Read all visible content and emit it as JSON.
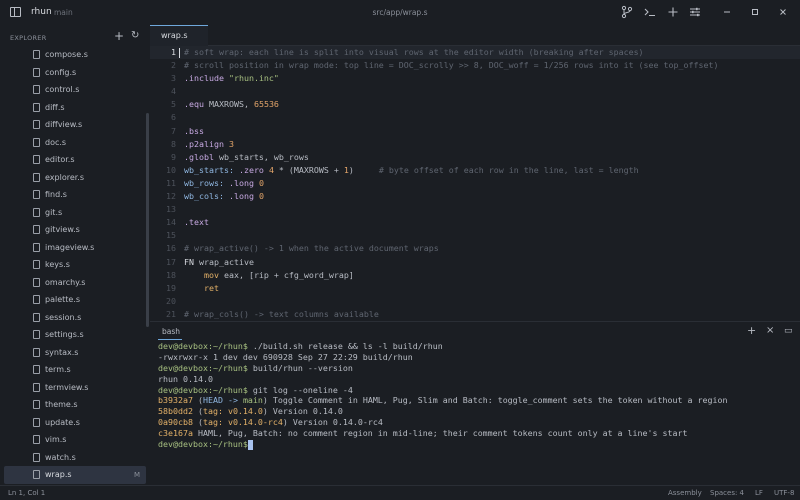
{
  "titlebar": {
    "app_name": "rhun",
    "branch": "main",
    "file_path": "src/app/wrap.s",
    "buttons": [
      "git-icon",
      "terminal-icon",
      "plus-icon",
      "sliders-icon"
    ],
    "window_controls": [
      "minimize",
      "maximize",
      "close"
    ]
  },
  "sidebar": {
    "header": "EXPLORER",
    "items": [
      {
        "label": "compose.s"
      },
      {
        "label": "config.s"
      },
      {
        "label": "control.s"
      },
      {
        "label": "diff.s"
      },
      {
        "label": "diffview.s"
      },
      {
        "label": "doc.s"
      },
      {
        "label": "editor.s"
      },
      {
        "label": "explorer.s"
      },
      {
        "label": "find.s"
      },
      {
        "label": "git.s"
      },
      {
        "label": "gitview.s"
      },
      {
        "label": "imageview.s"
      },
      {
        "label": "keys.s"
      },
      {
        "label": "omarchy.s"
      },
      {
        "label": "palette.s"
      },
      {
        "label": "session.s"
      },
      {
        "label": "settings.s"
      },
      {
        "label": "syntax.s"
      },
      {
        "label": "term.s"
      },
      {
        "label": "termview.s"
      },
      {
        "label": "theme.s"
      },
      {
        "label": "update.s"
      },
      {
        "label": "vim.s"
      },
      {
        "label": "watch.s"
      },
      {
        "label": "wrap.s",
        "badge": "M",
        "active": true
      }
    ]
  },
  "editor": {
    "tab_label": "wrap.s",
    "lines": [
      {
        "n": "1",
        "segs": [
          [
            "t-comment",
            "# soft wrap: each line is split into visual rows at the editor width (breaking after spaces)"
          ]
        ]
      },
      {
        "n": "2",
        "segs": [
          [
            "t-comment",
            "# scroll position in wrap mode: top line = DOC_scrolly >> 8, DOC_woff = 1/256 rows into it (see top_offset)"
          ]
        ]
      },
      {
        "n": "3",
        "segs": [
          [
            "t-dir",
            ".include "
          ],
          [
            "t-str",
            "\"rhun.inc\""
          ]
        ]
      },
      {
        "n": "4",
        "segs": []
      },
      {
        "n": "5",
        "segs": [
          [
            "t-dir",
            ".equ "
          ],
          [
            "t-plain",
            "MAXROWS, "
          ],
          [
            "t-num",
            "65536"
          ]
        ]
      },
      {
        "n": "6",
        "segs": []
      },
      {
        "n": "7",
        "segs": [
          [
            "t-dir",
            ".bss"
          ]
        ]
      },
      {
        "n": "8",
        "segs": [
          [
            "t-dir",
            ".p2align "
          ],
          [
            "t-num",
            "3"
          ]
        ]
      },
      {
        "n": "9",
        "segs": [
          [
            "t-dir",
            ".globl "
          ],
          [
            "t-plain",
            "wb_starts, wb_rows"
          ]
        ]
      },
      {
        "n": "10",
        "segs": [
          [
            "t-lab",
            "wb_starts: "
          ],
          [
            "t-dir",
            ".zero "
          ],
          [
            "t-num",
            "4"
          ],
          [
            "t-plain",
            " * (MAXROWS + "
          ],
          [
            "t-num",
            "1"
          ],
          [
            "t-plain",
            ")     "
          ],
          [
            "t-comment",
            "# byte offset of each row in the line, last = length"
          ]
        ]
      },
      {
        "n": "11",
        "segs": [
          [
            "t-lab",
            "wb_rows: "
          ],
          [
            "t-dir",
            ".long "
          ],
          [
            "t-num",
            "0"
          ]
        ]
      },
      {
        "n": "12",
        "segs": [
          [
            "t-lab",
            "wb_cols: "
          ],
          [
            "t-dir",
            ".long "
          ],
          [
            "t-num",
            "0"
          ]
        ]
      },
      {
        "n": "13",
        "segs": []
      },
      {
        "n": "14",
        "segs": [
          [
            "t-dir",
            ".text"
          ]
        ]
      },
      {
        "n": "15",
        "segs": []
      },
      {
        "n": "16",
        "segs": [
          [
            "t-comment",
            "# wrap_active() -> 1 when the active document wraps"
          ]
        ]
      },
      {
        "n": "17",
        "segs": [
          [
            "t-kw",
            "FN "
          ],
          [
            "t-plain",
            "wrap_active"
          ]
        ]
      },
      {
        "n": "18",
        "segs": [
          [
            "t-plain",
            "    "
          ],
          [
            "t-ins",
            "mov "
          ],
          [
            "t-plain",
            "eax, [rip + cfg_word_wrap]"
          ]
        ]
      },
      {
        "n": "19",
        "segs": [
          [
            "t-plain",
            "    "
          ],
          [
            "t-ins",
            "ret"
          ]
        ]
      },
      {
        "n": "20",
        "segs": []
      },
      {
        "n": "21",
        "segs": [
          [
            "t-comment",
            "# wrap_cols() -> text columns available"
          ]
        ]
      }
    ]
  },
  "terminal": {
    "tab_label": "bash",
    "lines": [
      [
        [
          "prompt",
          "dev@devbox:~/rhun$"
        ],
        [
          "plain",
          " ./build.sh release && ls -l build/rhun"
        ]
      ],
      [
        [
          "plain",
          "-rwxrwxr-x 1 dev dev 690928 Sep 27 22:29 build/rhun"
        ]
      ],
      [
        [
          "prompt",
          "dev@devbox:~/rhun$"
        ],
        [
          "plain",
          " build/rhun --version"
        ]
      ],
      [
        [
          "plain",
          "rhun 0.14.0"
        ]
      ],
      [
        [
          "prompt",
          "dev@devbox:~/rhun$"
        ],
        [
          "plain",
          " git log --oneline -4"
        ]
      ],
      [
        [
          "hash",
          "b3932a7"
        ],
        [
          "plain",
          " ("
        ],
        [
          "ref-head",
          "HEAD -> "
        ],
        [
          "ref-main",
          "main"
        ],
        [
          "plain",
          ") Toggle Comment in HAML, Pug, Slim and Batch: toggle_comment sets the token without a region"
        ]
      ],
      [
        [
          "hash",
          "58b0dd2"
        ],
        [
          "plain",
          " ("
        ],
        [
          "ref-tag",
          "tag: v0.14.0"
        ],
        [
          "plain",
          ") Version 0.14.0"
        ]
      ],
      [
        [
          "hash",
          "0a90cb8"
        ],
        [
          "plain",
          " ("
        ],
        [
          "ref-tag",
          "tag: v0.14.0-rc4"
        ],
        [
          "plain",
          ") Version 0.14.0-rc4"
        ]
      ],
      [
        [
          "hash",
          "c3e167a"
        ],
        [
          "plain",
          " HAML, Pug, Batch: no comment region in mid-line; their comment tokens count only at a line's start"
        ]
      ],
      [
        [
          "prompt",
          "dev@devbox:~/rhun$"
        ],
        [
          "cursor",
          ""
        ]
      ]
    ]
  },
  "statusbar": {
    "position": "Ln 1, Col 1",
    "language": "Assembly",
    "indent": "Spaces: 4",
    "eol": "LF",
    "encoding": "UTF-8"
  }
}
